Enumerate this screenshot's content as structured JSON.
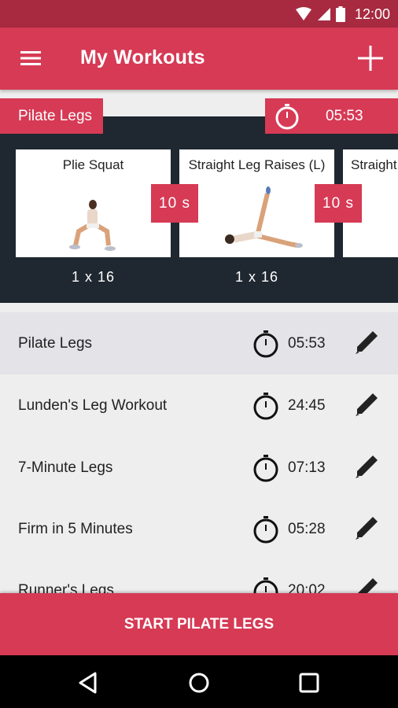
{
  "status_bar": {
    "time": "12:00",
    "icons": [
      "wifi-icon",
      "cell-signal-icon",
      "battery-icon"
    ]
  },
  "app_bar": {
    "title": "My Workouts",
    "menu_icon": "hamburger-menu-icon",
    "add_icon": "plus-icon"
  },
  "preview": {
    "workout_name": "Pilate Legs",
    "total_time": "05:53",
    "exercises": [
      {
        "name": "Plie Squat",
        "reps": "1 x 16"
      },
      {
        "name": "Straight Leg Raises (L)",
        "reps": "1 x 16"
      },
      {
        "name": "Straight Leg Raises (R)",
        "reps": ""
      }
    ],
    "rests": [
      "10 s",
      "10 s"
    ]
  },
  "workouts": [
    {
      "name": "Pilate Legs",
      "duration": "05:53",
      "selected": true
    },
    {
      "name": "Lunden's Leg Workout",
      "duration": "24:45",
      "selected": false
    },
    {
      "name": "7-Minute Legs",
      "duration": "07:13",
      "selected": false
    },
    {
      "name": "Firm in 5 Minutes",
      "duration": "05:28",
      "selected": false
    },
    {
      "name": "Runner's Legs",
      "duration": "20:02",
      "selected": false
    }
  ],
  "start_button": {
    "label": "START PILATE LEGS"
  },
  "colors": {
    "accent": "#d63a55",
    "status_bar": "#a72a40",
    "preview_bg": "#1f2730",
    "list_bg": "#eeeeee",
    "selected_row": "#e3e3e8"
  }
}
